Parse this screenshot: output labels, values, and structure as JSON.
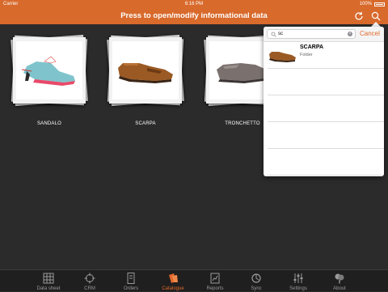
{
  "status_bar": {
    "carrier": "Carrier",
    "time": "6:16 PM",
    "battery": "100%"
  },
  "nav": {
    "title": "Press to open/modify informational data",
    "refresh_icon": "refresh-icon",
    "search_icon": "search-icon"
  },
  "catalogue": {
    "items": [
      {
        "label": "SANDALO",
        "image": "sandal-photo"
      },
      {
        "label": "SCARPA",
        "image": "loafer-photo"
      },
      {
        "label": "TRONCHETTO",
        "image": "grey-shoe-photo"
      }
    ]
  },
  "search": {
    "query": "sc",
    "cancel_label": "Cancel",
    "results": [
      {
        "title": "SCARPA",
        "subtitle": "Folder"
      }
    ]
  },
  "tabs": [
    {
      "label": "Data sheet",
      "icon": "grid-icon",
      "active": false
    },
    {
      "label": "CRM",
      "icon": "crosshair-icon",
      "active": false
    },
    {
      "label": "Orders",
      "icon": "document-icon",
      "active": false
    },
    {
      "label": "Catalogue",
      "icon": "catalogue-icon",
      "active": true
    },
    {
      "label": "Reports",
      "icon": "report-icon",
      "active": false
    },
    {
      "label": "Sync",
      "icon": "sync-icon",
      "active": false
    },
    {
      "label": "Settings",
      "icon": "settings-icon",
      "active": false
    },
    {
      "label": "About",
      "icon": "about-icon",
      "active": false
    }
  ],
  "colors": {
    "accent": "#D86A2C",
    "tab_active": "#E0682A",
    "background": "#2B2B2B"
  }
}
